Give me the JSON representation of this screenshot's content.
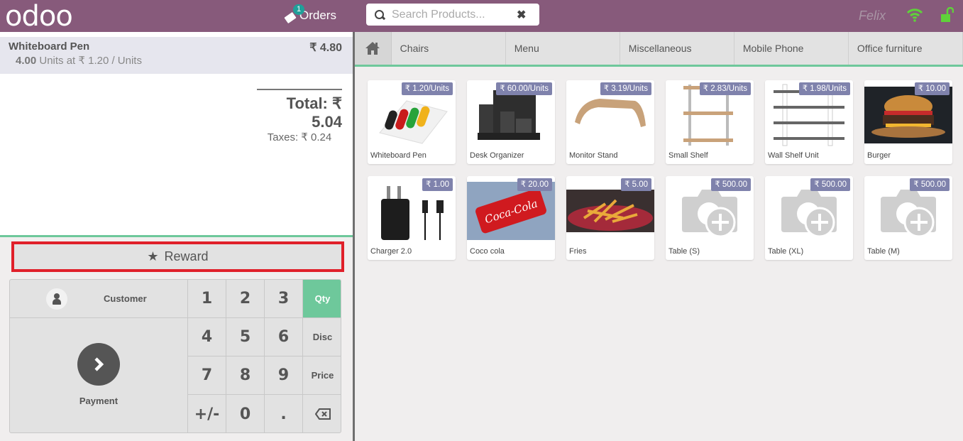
{
  "header": {
    "logo": "odoo",
    "orders_label": "Orders",
    "orders_count": "1",
    "search_placeholder": "Search Products...",
    "cashier": "Felix",
    "colors": {
      "topbar": "#875a7b",
      "accent": "#6ec89b",
      "badge": "#20a09a",
      "wifi": "#5fd13a",
      "lock": "#5fd13a"
    }
  },
  "order": {
    "lines": [
      {
        "name": "Whiteboard Pen",
        "price": "₹ 4.80",
        "qty": "4.00",
        "unit_info": "Units at ₹ 1.20 / Units"
      }
    ],
    "total": "Total: ₹ 5.04",
    "taxes": "Taxes: ₹ 0.24"
  },
  "controls": {
    "reward_label": "Reward",
    "customer_label": "Customer",
    "payment_label": "Payment",
    "keys": [
      "1",
      "2",
      "3",
      "Qty",
      "4",
      "5",
      "6",
      "Disc",
      "7",
      "8",
      "9",
      "Price",
      "+/-",
      "0",
      ".",
      "⌫"
    ],
    "active_mode": "Qty"
  },
  "categories": [
    "Chairs",
    "Menu",
    "Miscellaneous",
    "Mobile Phone",
    "Office furniture"
  ],
  "products": [
    {
      "name": "Whiteboard Pen",
      "price": "₹ 1.20/Units",
      "image": "whiteboard-pen"
    },
    {
      "name": "Desk Organizer",
      "price": "₹ 60.00/Units",
      "image": "desk-organizer"
    },
    {
      "name": "Monitor Stand",
      "price": "₹ 3.19/Units",
      "image": "monitor-stand"
    },
    {
      "name": "Small Shelf",
      "price": "₹ 2.83/Units",
      "image": "small-shelf"
    },
    {
      "name": "Wall Shelf Unit",
      "price": "₹ 1.98/Units",
      "image": "wall-shelf"
    },
    {
      "name": "Burger",
      "price": "₹ 10.00",
      "image": "burger"
    },
    {
      "name": "Charger 2.0",
      "price": "₹ 1.00",
      "image": "charger"
    },
    {
      "name": "Coco cola",
      "price": "₹ 20.00",
      "image": "coca-cola"
    },
    {
      "name": "Fries",
      "price": "₹ 5.00",
      "image": "fries"
    },
    {
      "name": "Table (S)",
      "price": "₹ 500.00",
      "image": "placeholder"
    },
    {
      "name": "Table (XL)",
      "price": "₹ 500.00",
      "image": "placeholder"
    },
    {
      "name": "Table (M)",
      "price": "₹ 500.00",
      "image": "placeholder"
    }
  ]
}
